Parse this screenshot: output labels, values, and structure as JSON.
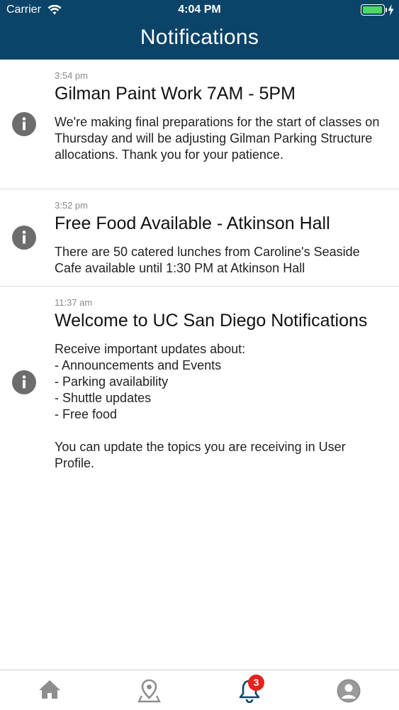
{
  "status_bar": {
    "carrier": "Carrier",
    "time": "4:04 PM",
    "battery_level": 0.9
  },
  "header": {
    "title": "Notifications"
  },
  "notifications": [
    {
      "time": "3:54 pm",
      "title": "Gilman Paint Work 7AM - 5PM",
      "body": "We're making final preparations for the start of classes on Thursday and will be adjusting Gilman Parking Structure allocations. Thank you for your patience."
    },
    {
      "time": "3:52 pm",
      "title": "Free Food Available - Atkinson Hall",
      "body": "There are 50 catered lunches from Caroline's Seaside Cafe available until 1:30 PM at Atkinson Hall"
    },
    {
      "time": "11:37 am",
      "title": "Welcome to UC San Diego Notifications",
      "body": "Receive important updates about:\n- Announcements and Events\n- Parking availability\n- Shuttle updates\n- Free food\n\nYou can update the topics you are receiving in User Profile."
    }
  ],
  "tabbar": {
    "tabs": [
      {
        "name": "home",
        "icon": "home-icon"
      },
      {
        "name": "map",
        "icon": "map-pin-icon"
      },
      {
        "name": "notifications",
        "icon": "bell-icon",
        "badge": "3",
        "active": true
      },
      {
        "name": "profile",
        "icon": "user-icon"
      }
    ]
  },
  "colors": {
    "header_bg": "#0b4468",
    "badge": "#e8201e",
    "active_tab": "#0b4468",
    "inactive_tab": "#8e8e8e",
    "info_icon": "#6d6d6d"
  }
}
